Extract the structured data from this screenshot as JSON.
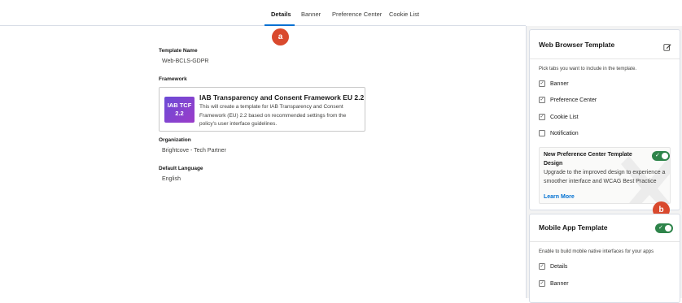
{
  "tabs": [
    {
      "label": "Details",
      "active": true
    },
    {
      "label": "Banner",
      "active": false
    },
    {
      "label": "Preference Center",
      "active": false
    },
    {
      "label": "Cookie List",
      "active": false
    }
  ],
  "markers": {
    "a": "a",
    "b": "b"
  },
  "details": {
    "template_name_label": "Template Name",
    "template_name_value": "Web-BCLS-GDPR",
    "framework_label": "Framework",
    "framework": {
      "logo_line1": "IAB TCF",
      "logo_line2": "2.2",
      "title": "IAB Transparency and Consent Framework EU 2.2",
      "description": "This will create a template for IAB Transparency and Consent Framework (EU) 2.2 based on recommended settings from the policy's user interface guidelines."
    },
    "organization_label": "Organization",
    "organization_value": "Brightcove - Tech Partner",
    "language_label": "Default Language",
    "language_value": "English"
  },
  "web_template": {
    "title": "Web Browser Template",
    "description": "Pick tabs you want to include in the template.",
    "items": [
      {
        "label": "Banner",
        "checked": true
      },
      {
        "label": "Preference Center",
        "checked": true
      },
      {
        "label": "Cookie List",
        "checked": true
      },
      {
        "label": "Notification",
        "checked": false
      }
    ],
    "upgrade": {
      "title": "New Preference Center Template Design",
      "description": "Upgrade to the improved design to experience a smoother interface and WCAG Best Practice",
      "link": "Learn More",
      "enabled": true
    }
  },
  "mobile_template": {
    "title": "Mobile App Template",
    "enabled": true,
    "description": "Enable to build mobile native interfaces for your apps",
    "items": [
      {
        "label": "Details",
        "checked": true
      },
      {
        "label": "Banner",
        "checked": true
      }
    ]
  },
  "colors": {
    "accent": "#0070d2",
    "marker": "#d9492d",
    "toggle_on": "#2e844a",
    "tcf_logo": "#7b45d4"
  }
}
